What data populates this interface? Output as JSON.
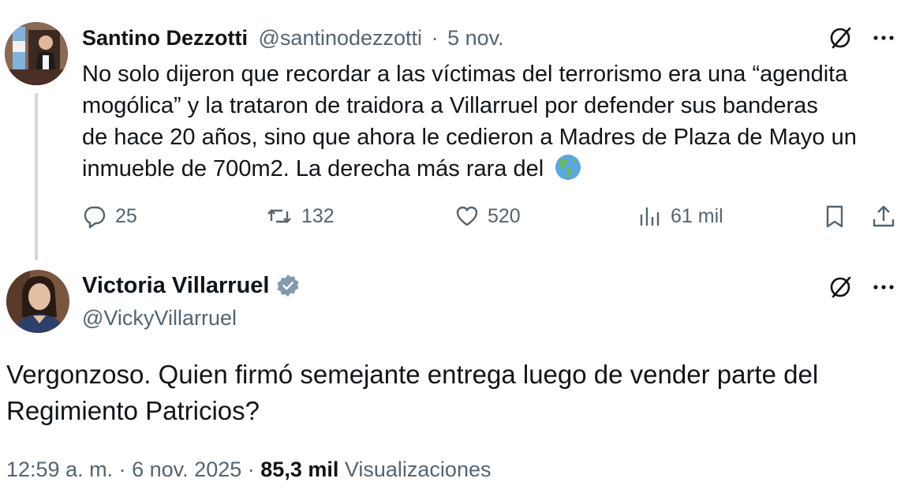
{
  "reply_to": {
    "name": "Santino Dezzotti",
    "handle": "@santinodezzotti",
    "separator": "·",
    "date": "5 nov.",
    "text_lines": [
      "No solo dijeron que recordar a las víctimas del terrorismo era una “agendita",
      "mogólica” y la trataron de traidora a Villarruel por defender sus banderas",
      "de hace 20 años, sino que ahora le cedieron a Madres de Plaza de Mayo un",
      "inmueble de 700m2. La derecha más rara del"
    ],
    "emoji_icon": "globe-americas-icon",
    "stats": {
      "replies": "25",
      "reposts": "132",
      "likes": "520",
      "views": "61 mil"
    }
  },
  "main_post": {
    "name": "Victoria Villarruel",
    "handle": "@VickyVillarruel",
    "verified": true,
    "text_lines": [
      "Vergonzoso. Quien firmó semejante entrega luego de vender parte del",
      "Regimiento Patricios?"
    ],
    "footer": {
      "time": "12:59 a. m.",
      "sep1": "·",
      "date": "6 nov. 2025",
      "sep2": "·",
      "views_count": "85,3 mil",
      "views_label": "Visualizaciones"
    }
  },
  "colors": {
    "text": "#0f1419",
    "muted": "#536471",
    "thread_line": "#cfd9de",
    "verified_badge": "#829aab"
  }
}
